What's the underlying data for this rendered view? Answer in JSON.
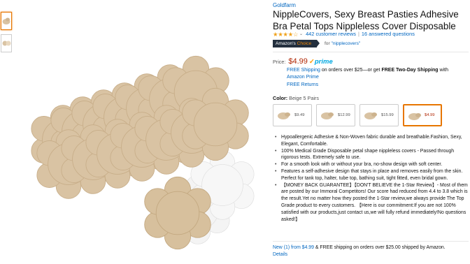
{
  "thumbnails": [
    {
      "label": "thumbnail-1",
      "selected": true
    },
    {
      "label": "thumbnail-2",
      "selected": false
    }
  ],
  "product": {
    "brand": "Goldfarm",
    "title": "NippleCovers, Sexy Breast Pasties Adhesive Bra Petal Tops Nippleless Cover Disposable",
    "rating_stars": "★★★★☆",
    "reviews": "442 customer reviews",
    "questions": "16 answered questions",
    "badge_prefix": "Amazon's",
    "badge_suffix": "Choice",
    "choice_for_prefix": "for",
    "choice_for_term": "\"nipplecovers\""
  },
  "pricing": {
    "label": "Price:",
    "price": "$4.99",
    "prime_label": "prime",
    "free_shipping_link": "FREE Shipping",
    "shipping_text": "on orders over $25—or get",
    "two_day": "FREE Two-Day Shipping",
    "with_text": "with",
    "amazon_prime_link": "Amazon Prime",
    "free_returns_link": "FREE Returns"
  },
  "color": {
    "label": "Color:",
    "value": "Beige 5 Pairs",
    "swatches": [
      {
        "price": "$9.49",
        "selected": false
      },
      {
        "price": "$12.99",
        "selected": false
      },
      {
        "price": "$15.99",
        "selected": false
      },
      {
        "price": "$4.99",
        "selected": true
      }
    ]
  },
  "bullets": [
    "Hypoallergenic Adhesive & Non-Woven fabric durable and breathable.Fashion, Sexy, Elegant, Comfortable.",
    "100% Medical Grade Disposable petal shape nippleless covers - Passed through rigorous tests. Extremely safe to use.",
    "For a smooth look with or without your bra, no-show design with soft center.",
    "Features a self-adhesive design that stays in place and removes easily from the skin. Perfect for tank top, halter, tube top, bathing suit, tight fitted, even bridal gown.",
    "【MONEY BACK GUARANTEE】【DON'T BELIEVE the 1-Star Review】- Most of them are posted by our Immoral Competitors! Our score had reduced from 4.4 to 3.8 which is the result.Yet no matter how they posted the 1-Star review,we always provide The Top Grade product to every customers. 【Here is our commitment:If you are not 100% satisfied with our products,just contact us,we will fully refund immediately!No questions asked!】"
  ],
  "offers": {
    "new_link": "New (1) from $4.99",
    "text": "& FREE shipping on orders over $25.00 shipped by Amazon.",
    "details_link": "Details"
  },
  "colors": {
    "link": "#0066c0",
    "price": "#b12704",
    "star": "#f0a21b",
    "selected_border": "#e77600",
    "badge_bg": "#232f3e",
    "petal": "#d9c3a3",
    "petal_edge": "#c7ad88"
  }
}
